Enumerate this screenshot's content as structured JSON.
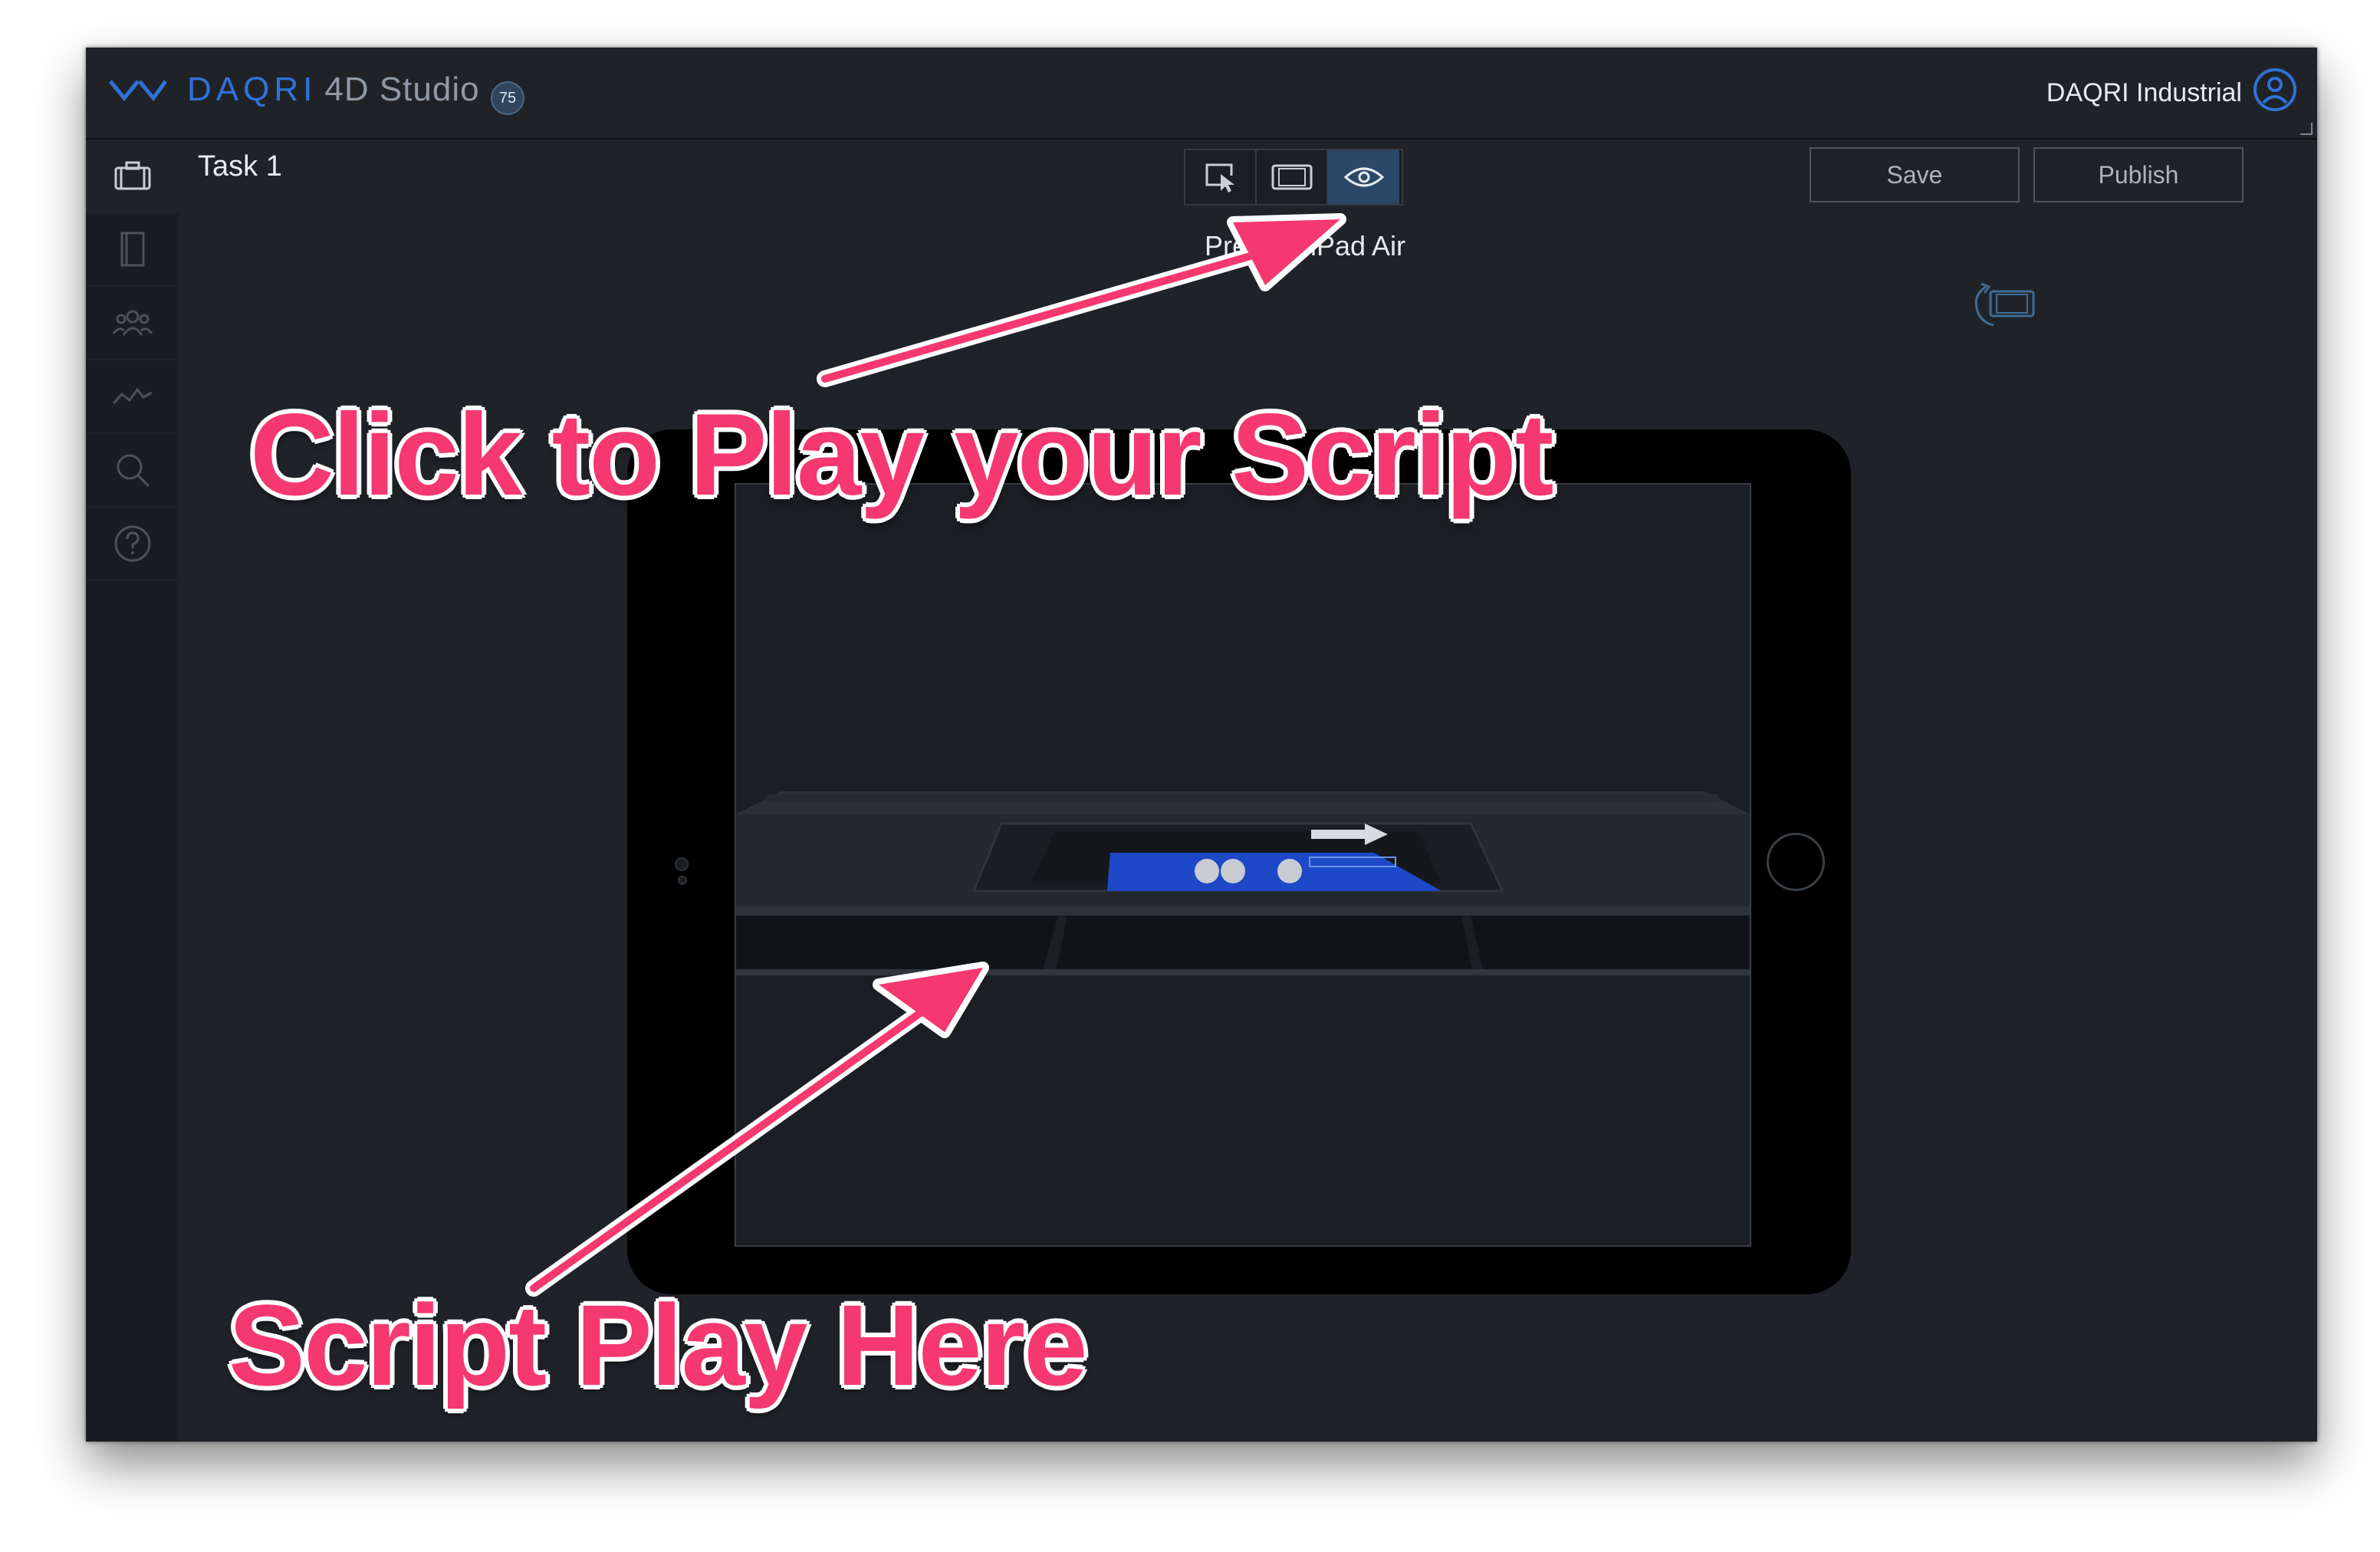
{
  "app": {
    "brand": "DAQRI",
    "name": "4D Studio",
    "version_badge": "75",
    "account": "DAQRI Industrial"
  },
  "sidebar": {
    "items": [
      {
        "icon": "briefcase-icon"
      },
      {
        "icon": "book-icon"
      },
      {
        "icon": "users-icon"
      },
      {
        "icon": "activity-icon"
      },
      {
        "icon": "search-icon"
      },
      {
        "icon": "help-icon"
      }
    ]
  },
  "toolbar": {
    "task_title": "Task 1",
    "modes": [
      {
        "icon": "select-cursor-icon",
        "active": false
      },
      {
        "icon": "tablet-icon",
        "active": false
      },
      {
        "icon": "eye-icon",
        "active": true
      }
    ],
    "save_label": "Save",
    "publish_label": "Publish"
  },
  "preview": {
    "label": "Preview iPad Air"
  },
  "annotations": {
    "play_hint": "Click to Play your Script",
    "play_area": "Script Play Here",
    "color": "#f5386f"
  },
  "colors": {
    "brand": "#2f72d8",
    "window_bg": "#1f2328",
    "active_mode": "#2c4868"
  }
}
